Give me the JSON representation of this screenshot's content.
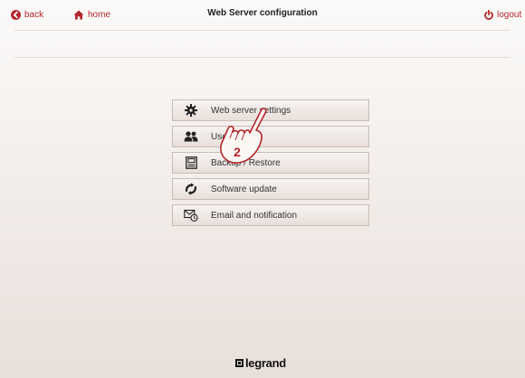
{
  "header": {
    "back_label": "back",
    "home_label": "home",
    "title": "Web Server configuration",
    "logout_label": "logout",
    "accent_color": "#b3262b"
  },
  "menu": {
    "items": [
      {
        "label": "Web server settings",
        "icon": "gear-icon"
      },
      {
        "label": "Users",
        "icon": "users-icon"
      },
      {
        "label": "Backup / Restore",
        "icon": "backup-restore-icon"
      },
      {
        "label": "Software update",
        "icon": "software-update-icon"
      },
      {
        "label": "Email and notification",
        "icon": "email-notification-icon"
      }
    ]
  },
  "callout": {
    "step_number": "2"
  },
  "footer": {
    "brand": "legrand"
  }
}
